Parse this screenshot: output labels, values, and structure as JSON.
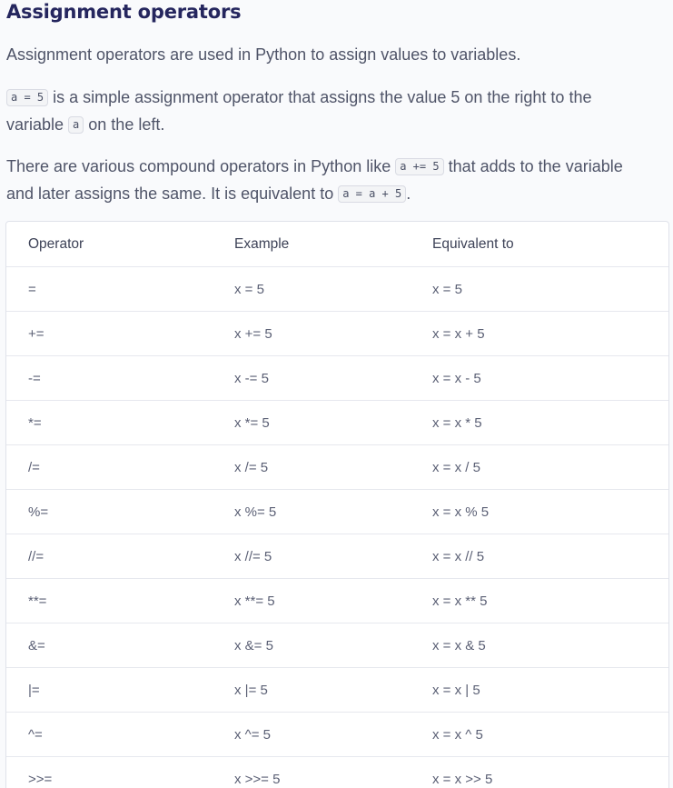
{
  "title": "Assignment operators",
  "paragraph1": "Assignment operators are used in Python to assign values to variables.",
  "paragraph2": {
    "code1": "a = 5",
    "text1": " is a simple assignment operator that assigns the value 5 on the right to the",
    "text2": "variable ",
    "code2": "a",
    "text3": " on the left."
  },
  "paragraph3": {
    "text1": "There are various compound operators in Python like ",
    "code1": "a += 5",
    "text2": " that adds to the variable",
    "text3": "and later assigns the same. It is equivalent to ",
    "code2": "a = a + 5",
    "text4": "."
  },
  "table": {
    "headers": [
      "Operator",
      "Example",
      "Equivalent to"
    ],
    "rows": [
      [
        "=",
        "x = 5",
        "x = 5"
      ],
      [
        "+=",
        "x += 5",
        "x = x + 5"
      ],
      [
        "-=",
        "x -= 5",
        "x = x - 5"
      ],
      [
        "*=",
        "x *= 5",
        "x = x * 5"
      ],
      [
        "/=",
        "x /= 5",
        "x = x / 5"
      ],
      [
        "%=",
        "x %= 5",
        "x = x % 5"
      ],
      [
        "//=",
        "x //= 5",
        "x = x // 5"
      ],
      [
        "**=",
        "x **= 5",
        "x = x ** 5"
      ],
      [
        "&=",
        "x &= 5",
        "x = x & 5"
      ],
      [
        "|=",
        "x |= 5",
        "x = x | 5"
      ],
      [
        "^=",
        "x ^= 5",
        "x = x ^ 5"
      ],
      [
        ">>=",
        "x >>= 5",
        "x = x >> 5"
      ]
    ]
  }
}
